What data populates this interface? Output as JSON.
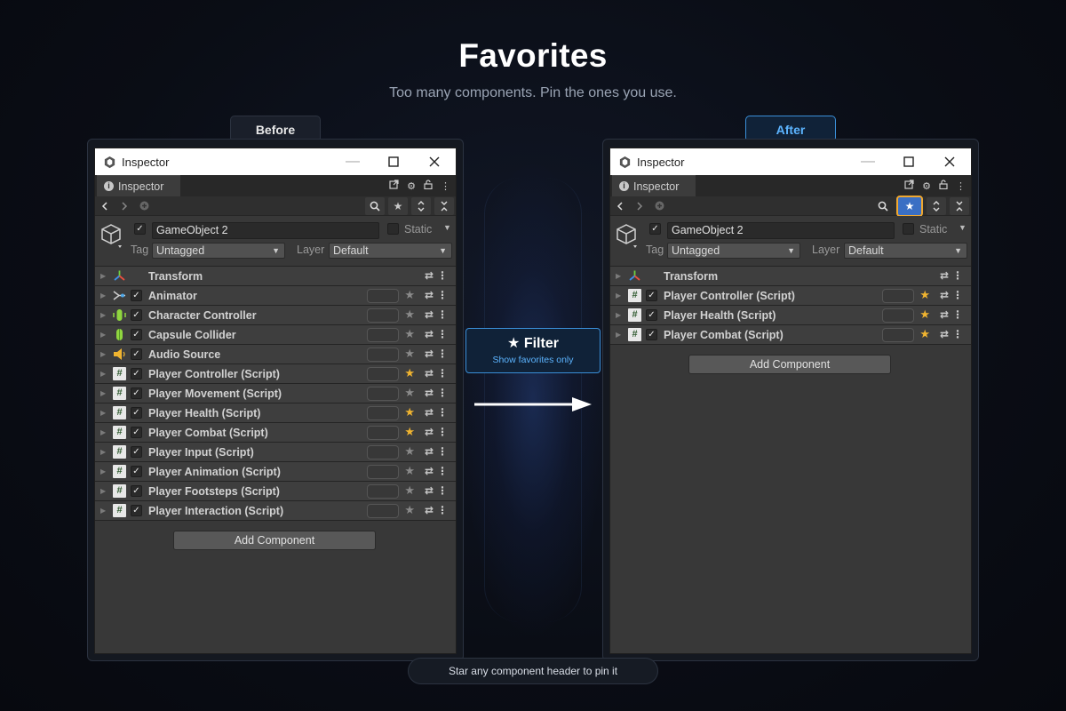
{
  "page": {
    "title": "Favorites",
    "subtitle": "Too many components. Pin the ones you use."
  },
  "labels": {
    "before": "Before",
    "after": "After"
  },
  "window": {
    "title": "Inspector",
    "tab": "Inspector",
    "gameobject_name": "GameObject 2",
    "static_label": "Static",
    "tag_label": "Tag",
    "tag_value": "Untagged",
    "layer_label": "Layer",
    "layer_value": "Default",
    "transform": "Transform",
    "add_component": "Add Component"
  },
  "before_components": [
    {
      "name": "Animator",
      "icon": "animator-icon",
      "favorite": false
    },
    {
      "name": "Character Controller",
      "icon": "character-controller-icon",
      "favorite": false
    },
    {
      "name": "Capsule Collider",
      "icon": "capsule-collider-icon",
      "favorite": false
    },
    {
      "name": "Audio Source",
      "icon": "audio-source-icon",
      "favorite": false
    },
    {
      "name": "Player Controller (Script)",
      "icon": "script-icon",
      "favorite": true
    },
    {
      "name": "Player Movement (Script)",
      "icon": "script-icon",
      "favorite": false
    },
    {
      "name": "Player Health (Script)",
      "icon": "script-icon",
      "favorite": true
    },
    {
      "name": "Player Combat (Script)",
      "icon": "script-icon",
      "favorite": true
    },
    {
      "name": "Player Input (Script)",
      "icon": "script-icon",
      "favorite": false
    },
    {
      "name": "Player Animation (Script)",
      "icon": "script-icon",
      "favorite": false
    },
    {
      "name": "Player Footsteps (Script)",
      "icon": "script-icon",
      "favorite": false
    },
    {
      "name": "Player Interaction (Script)",
      "icon": "script-icon",
      "favorite": false
    }
  ],
  "after_components": [
    {
      "name": "Player Controller (Script)",
      "icon": "script-icon",
      "favorite": true
    },
    {
      "name": "Player Health (Script)",
      "icon": "script-icon",
      "favorite": true
    },
    {
      "name": "Player Combat (Script)",
      "icon": "script-icon",
      "favorite": true
    }
  ],
  "filter": {
    "title": "★ Filter",
    "subtitle": "Show favorites only"
  },
  "tip": "Star any component header to pin it",
  "colors": {
    "favorite_star": "#f0b430",
    "accent_blue": "#3a8fd8",
    "active_filter": "#3a6fc4",
    "highlight_border": "#f0a830"
  }
}
